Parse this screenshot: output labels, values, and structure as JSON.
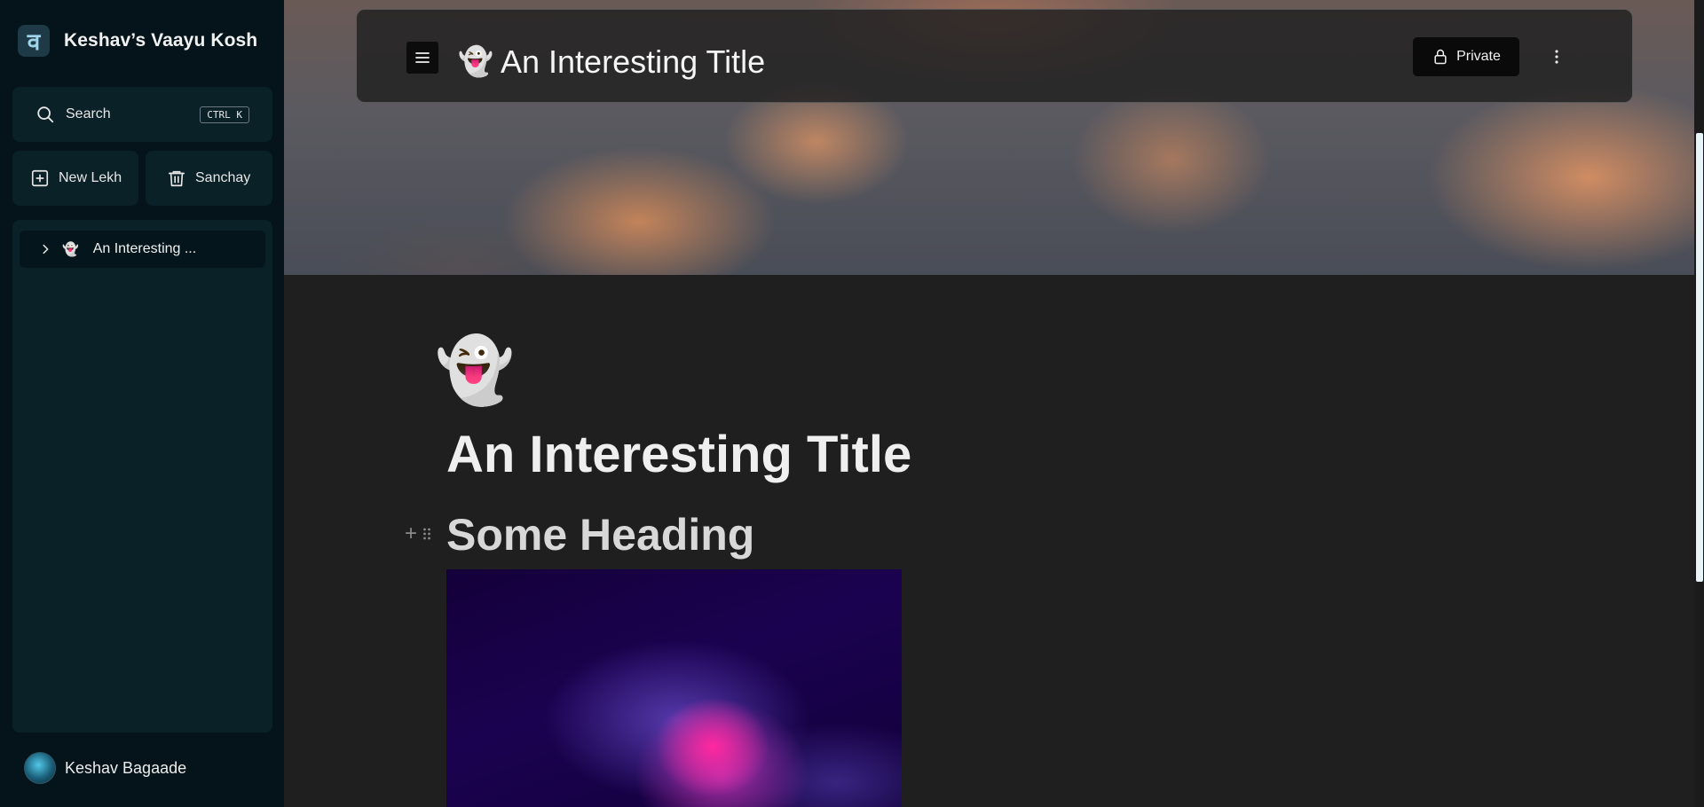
{
  "sidebar": {
    "brand": {
      "logo_glyph": "व",
      "name": "Keshav’s Vaayu Kosh"
    },
    "search": {
      "label": "Search",
      "shortcut": "CTRL K",
      "icon": "search-icon"
    },
    "actions": {
      "new_label": "New Lekh",
      "new_icon": "plus-square-icon",
      "trash_label": "Sanchay",
      "trash_icon": "trash-icon"
    },
    "documents": [
      {
        "emoji": "👻",
        "label": "An Interesting ..."
      }
    ],
    "user": {
      "name": "Keshav Bagaade"
    }
  },
  "topbar": {
    "emoji": "👻",
    "title": "An Interesting Title",
    "privacy_label": "Private"
  },
  "page": {
    "emoji": "👻",
    "title": "An Interesting Title",
    "blocks": [
      {
        "type": "heading",
        "text": "Some Heading"
      },
      {
        "type": "image"
      }
    ]
  },
  "colors": {
    "sidebar_bg": "#04141a",
    "panel_bg": "#0a2128",
    "main_bg": "#1f1f1f",
    "accent": "#9fd4ea"
  }
}
